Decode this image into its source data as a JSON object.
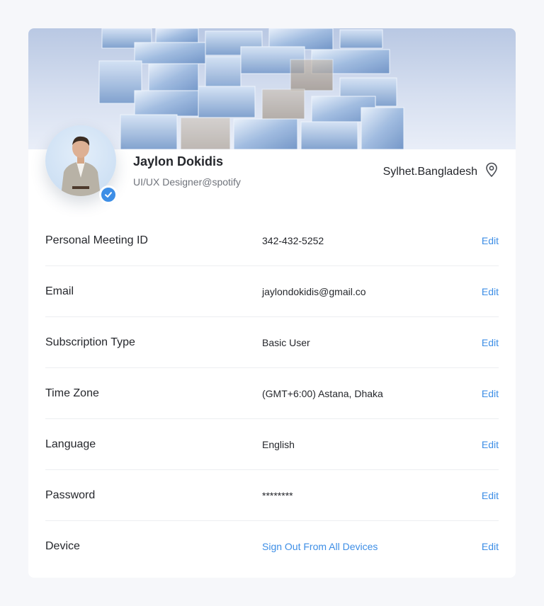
{
  "profile": {
    "name": "Jaylon Dokidis",
    "role": "UI/UX Designer@spotify",
    "location": "Sylhet.Bangladesh",
    "verified": true
  },
  "settings": {
    "rows": [
      {
        "label": "Personal Meeting ID",
        "value": "342-432-5252",
        "edit": "Edit"
      },
      {
        "label": "Email",
        "value": "jaylondokidis@gmail.co",
        "edit": "Edit"
      },
      {
        "label": "Subscription Type",
        "value": "Basic User",
        "edit": "Edit"
      },
      {
        "label": "Time Zone",
        "value": "(GMT+6:00) Astana, Dhaka",
        "edit": "Edit"
      },
      {
        "label": "Language",
        "value": "English",
        "edit": "Edit"
      },
      {
        "label": "Password",
        "value": "********",
        "edit": "Edit"
      },
      {
        "label": "Device",
        "value": "Sign Out From All Devices",
        "edit": "Edit"
      }
    ]
  },
  "colors": {
    "accent": "#3d8ee6",
    "text": "#25272c",
    "muted": "#6f737b",
    "page_bg": "#f6f7fa"
  }
}
